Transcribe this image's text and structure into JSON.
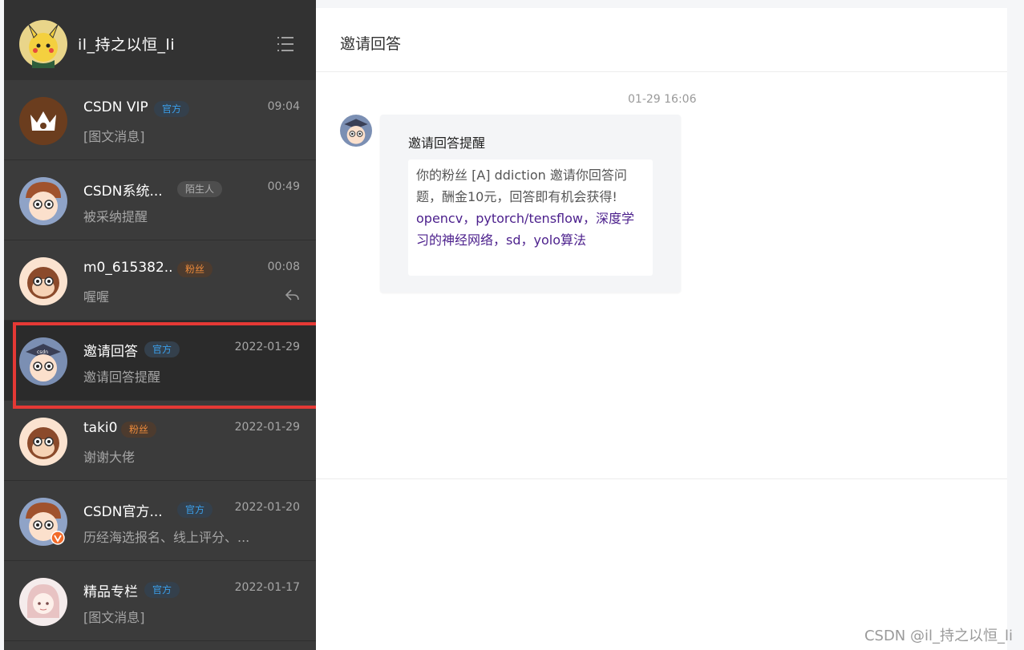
{
  "sidebar": {
    "username": "il_持之以恒_li",
    "conversations": [
      {
        "name": "CSDN VIP",
        "badge": "官方",
        "badge_type": "official",
        "time": "09:04",
        "preview": "[图文消息]",
        "avatar": "crown-avatar"
      },
      {
        "name": "CSDN系统...",
        "badge": "陌生人",
        "badge_type": "stranger",
        "time": "00:49",
        "preview": "被采纳提醒",
        "avatar": "cartoon-boy-avatar"
      },
      {
        "name": "m0_615382...",
        "badge": "粉丝",
        "badge_type": "fan",
        "time": "00:08",
        "preview": "喔喔",
        "avatar": "monkey-avatar"
      },
      {
        "name": "邀请回答",
        "badge": "官方",
        "badge_type": "official",
        "time": "2022-01-29",
        "preview": "邀请回答提醒",
        "avatar": "graduate-avatar"
      },
      {
        "name": "taki0",
        "badge": "粉丝",
        "badge_type": "fan",
        "time": "2022-01-29",
        "preview": "谢谢大佬",
        "avatar": "monkey-avatar"
      },
      {
        "name": "CSDN官方...",
        "badge": "官方",
        "badge_type": "official",
        "time": "2022-01-20",
        "preview": "历经海选报名、线上评分、...",
        "avatar": "verified-boy-avatar"
      },
      {
        "name": "精品专栏",
        "badge": "官方",
        "badge_type": "official",
        "time": "2022-01-17",
        "preview": "[图文消息]",
        "avatar": "anime-girl-avatar"
      }
    ]
  },
  "main": {
    "title": "邀请回答",
    "message": {
      "time": "01-29 16:06",
      "card_title": "邀请回答提醒",
      "body_text": "你的粉丝 [A] ddiction 邀请你回答问题，酬金10元，回答即有机会获得!",
      "link_text": "opencv，pytorch/tensflow，深度学习的神经网络，sd，yolo算法"
    }
  },
  "watermark": "CSDN @il_持之以恒_li",
  "colors": {
    "sidebar_bg": "#3b3b3b",
    "active_row": "#2b2b2b",
    "official_badge": "#3b9fe9",
    "fan_badge": "#ec8a3b",
    "link": "#4b1f8c",
    "highlight": "#e53935"
  },
  "icons": {
    "menu": "menu-lines-icon",
    "reply": "reply-arrow-icon"
  }
}
